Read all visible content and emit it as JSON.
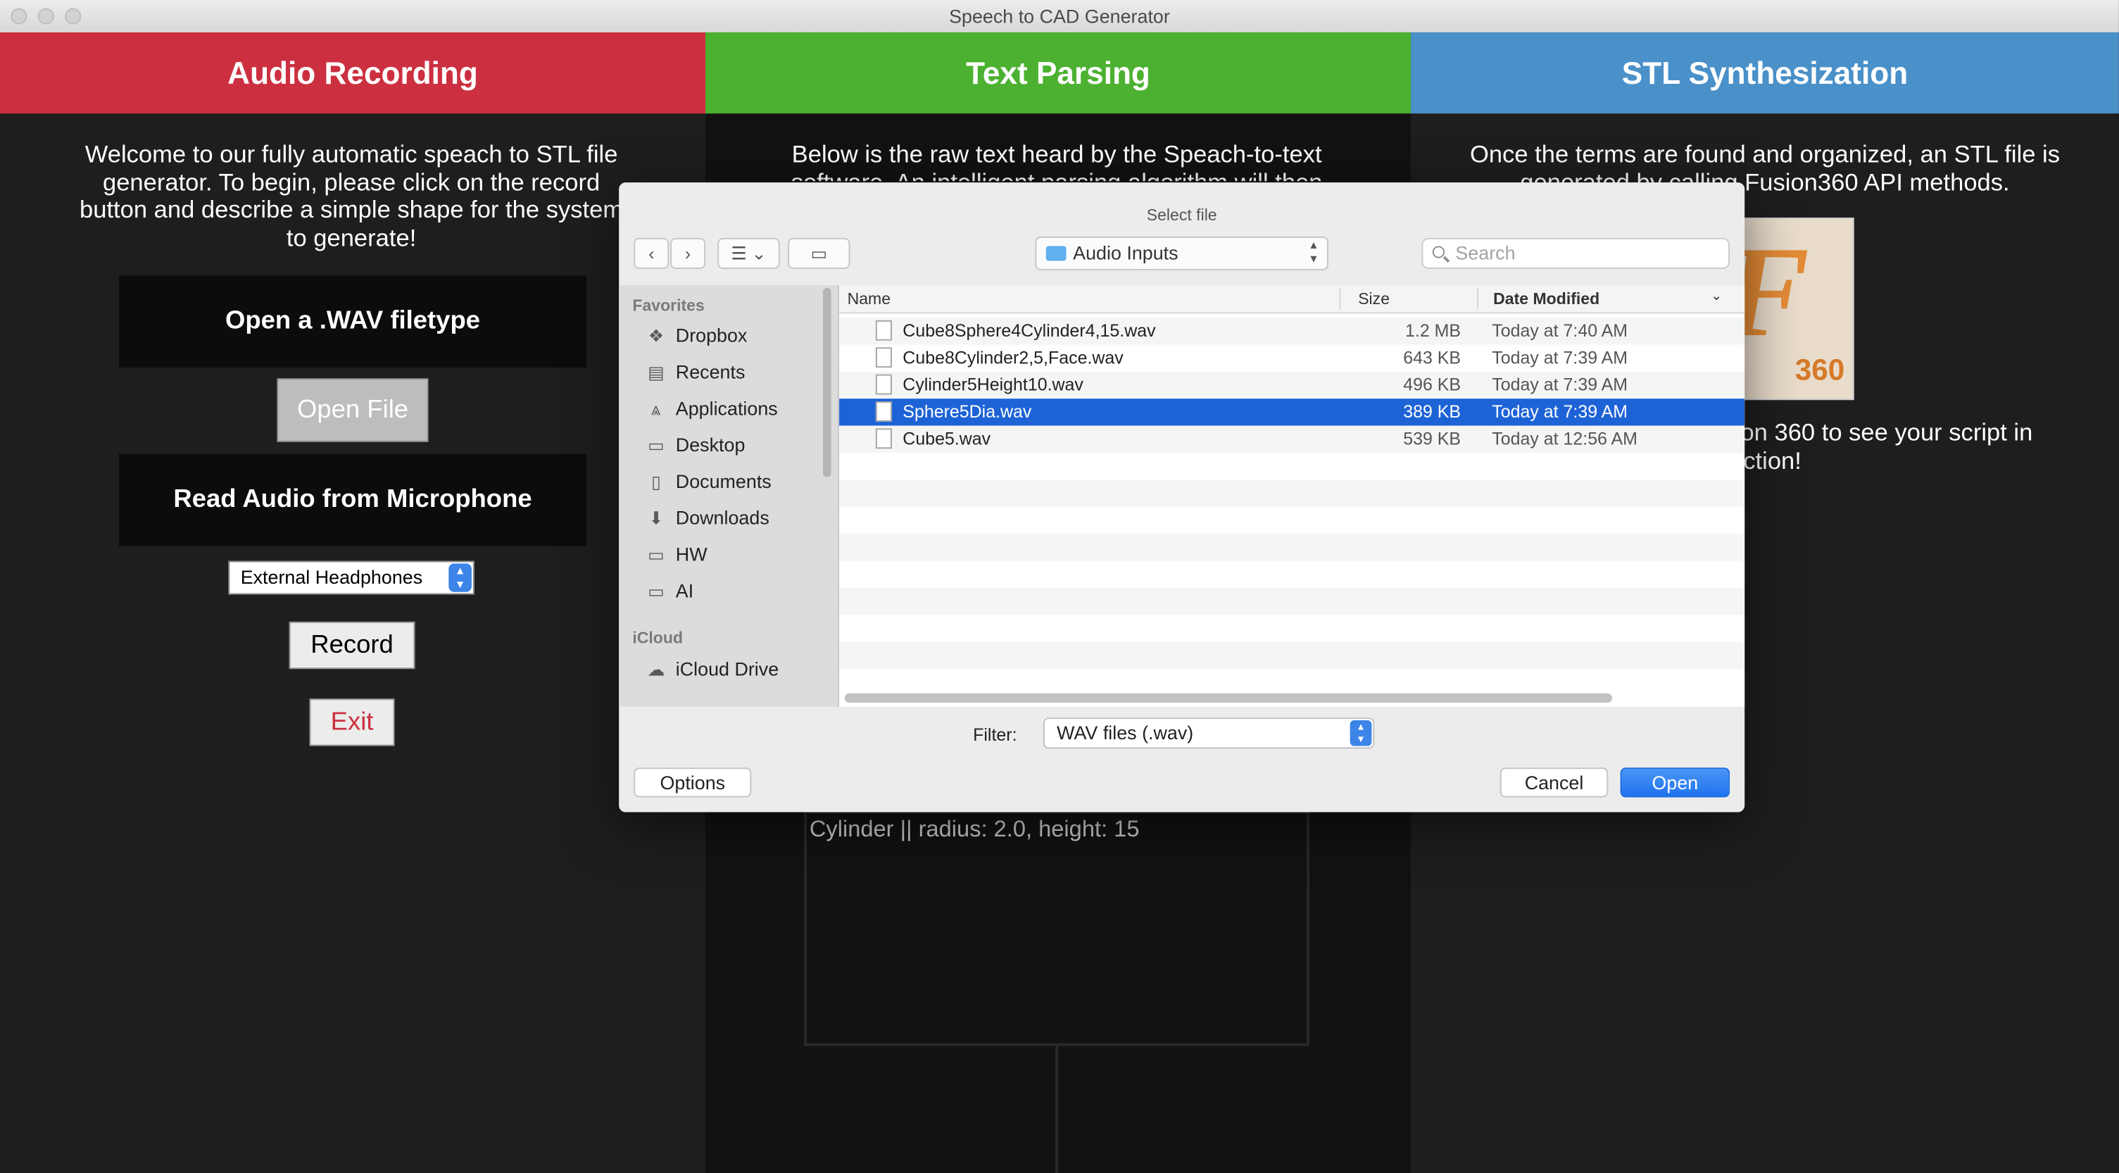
{
  "window": {
    "title": "Speech to CAD Generator"
  },
  "columns": {
    "audio": {
      "title": "Audio Recording",
      "color": "#cc3040",
      "intro": "Welcome to our fully automatic speach to STL file generator. To begin, please click on the record button and describe a simple shape for the system to generate!",
      "open_heading": "Open a .WAV filetype",
      "open_button": "Open File",
      "mic_heading": "Read Audio from Microphone",
      "mic_selected": "External Headphones",
      "record_button": "Record",
      "exit_button": "Exit"
    },
    "text": {
      "title": "Text Parsing",
      "color": "#4cb131",
      "intro": "Below is the raw text heard by the Speach-to-text software. An intelligent parsing algorithm will then",
      "parsed_line": "Cylinder || radius: 2.0, height: 15"
    },
    "stl": {
      "title": "STL Synthesization",
      "color": "#4a90c9",
      "intro": "Once the terms are found and organized, an STL file is generated by calling Fusion360 API methods.",
      "logo_text": "360",
      "fusion_line1": "on 360 to see your script in",
      "fusion_line2": "ction!"
    }
  },
  "dialog": {
    "title": "Select file",
    "location": "Audio Inputs",
    "search_placeholder": "Search",
    "sidebar": {
      "favorites_label": "Favorites",
      "favorites": [
        {
          "label": "Dropbox",
          "icon": "dropbox-icon"
        },
        {
          "label": "Recents",
          "icon": "recents-icon"
        },
        {
          "label": "Applications",
          "icon": "applications-icon"
        },
        {
          "label": "Desktop",
          "icon": "desktop-icon"
        },
        {
          "label": "Documents",
          "icon": "documents-icon"
        },
        {
          "label": "Downloads",
          "icon": "downloads-icon"
        },
        {
          "label": "HW",
          "icon": "folder-icon"
        },
        {
          "label": "AI",
          "icon": "folder-icon"
        }
      ],
      "icloud_label": "iCloud",
      "icloud": [
        {
          "label": "iCloud Drive",
          "icon": "cloud-icon"
        }
      ]
    },
    "columns": {
      "name": "Name",
      "size": "Size",
      "date": "Date Modified"
    },
    "files": [
      {
        "name": "Cube8Sphere4Cylinder4,15.wav",
        "size": "1.2 MB",
        "date": "Today at 7:40 AM",
        "selected": false
      },
      {
        "name": "Cube8Cylinder2,5,Face.wav",
        "size": "643 KB",
        "date": "Today at 7:39 AM",
        "selected": false
      },
      {
        "name": "Cylinder5Height10.wav",
        "size": "496 KB",
        "date": "Today at 7:39 AM",
        "selected": false
      },
      {
        "name": "Sphere5Dia.wav",
        "size": "389 KB",
        "date": "Today at 7:39 AM",
        "selected": true
      },
      {
        "name": "Cube5.wav",
        "size": "539 KB",
        "date": "Today at 12:56 AM",
        "selected": false
      }
    ],
    "filter_label": "Filter:",
    "filter_selected": "WAV files (.wav)",
    "options_button": "Options",
    "cancel_button": "Cancel",
    "open_button": "Open",
    "accent": "#1e63d6"
  }
}
